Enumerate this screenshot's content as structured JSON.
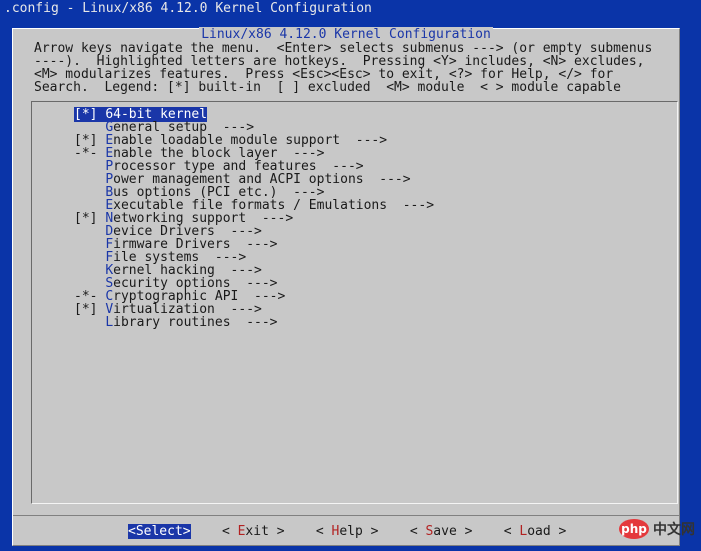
{
  "top_bar": {
    "text": ".config - Linux/x86 4.12.0 Kernel Configuration"
  },
  "dialog": {
    "title": "Linux/x86 4.12.0 Kernel Configuration"
  },
  "help_lines": [
    "Arrow keys navigate the menu.  <Enter> selects submenus ---> (or empty submenus",
    "----).  Highlighted letters are hotkeys.  Pressing <Y> includes, <N> excludes,",
    "<M> modularizes features.  Press <Esc><Esc> to exit, <?> for Help, </> for",
    "Search.  Legend: [*] built-in  [ ] excluded  <M> module  < > module capable"
  ],
  "menu": {
    "items": [
      {
        "prefix": "[*] ",
        "hot": "6",
        "rest": "4-bit kernel",
        "selected": true
      },
      {
        "prefix": "    ",
        "hot": "G",
        "rest": "eneral setup  --->"
      },
      {
        "prefix": "[*] ",
        "hot": "E",
        "rest": "nable loadable module support  --->"
      },
      {
        "prefix": "-*- ",
        "hot": "E",
        "rest": "nable the block layer  --->"
      },
      {
        "prefix": "    ",
        "hot": "P",
        "rest": "rocessor type and features  --->"
      },
      {
        "prefix": "    ",
        "hot": "P",
        "rest": "ower management and ACPI options  --->"
      },
      {
        "prefix": "    ",
        "hot": "B",
        "rest": "us options (PCI etc.)  --->"
      },
      {
        "prefix": "    ",
        "hot": "E",
        "rest": "xecutable file formats / Emulations  --->"
      },
      {
        "prefix": "[*] ",
        "hot": "N",
        "rest": "etworking support  --->"
      },
      {
        "prefix": "    ",
        "hot": "D",
        "rest": "evice Drivers  --->"
      },
      {
        "prefix": "    ",
        "hot": "F",
        "rest": "irmware Drivers  --->"
      },
      {
        "prefix": "    ",
        "hot": "F",
        "rest": "ile systems  --->"
      },
      {
        "prefix": "    ",
        "hot": "K",
        "rest": "ernel hacking  --->"
      },
      {
        "prefix": "    ",
        "hot": "S",
        "rest": "ecurity options  --->"
      },
      {
        "prefix": "-*- ",
        "hot": "C",
        "rest": "ryptographic API  --->"
      },
      {
        "prefix": "[*] ",
        "hot": "V",
        "rest": "irtualization  --->"
      },
      {
        "prefix": "    ",
        "hot": "L",
        "rest": "ibrary routines  --->"
      }
    ]
  },
  "buttons": [
    {
      "name": "select-button",
      "pre": "<",
      "hot": "S",
      "rest": "elect>",
      "active": true
    },
    {
      "name": "exit-button",
      "pre": "< ",
      "hot": "E",
      "rest": "xit >",
      "active": false
    },
    {
      "name": "help-button",
      "pre": "< ",
      "hot": "H",
      "rest": "elp >",
      "active": false
    },
    {
      "name": "save-button",
      "pre": "< ",
      "hot": "S",
      "rest": "ave >",
      "active": false
    },
    {
      "name": "load-button",
      "pre": "< ",
      "hot": "L",
      "rest": "oad >",
      "active": false
    }
  ],
  "watermark": {
    "badge": "php",
    "text": "中文网"
  }
}
